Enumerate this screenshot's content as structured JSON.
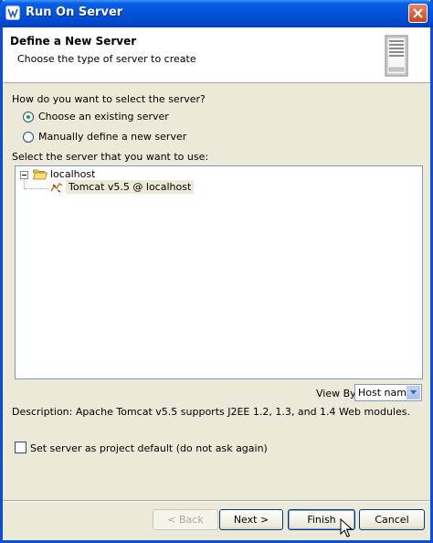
{
  "window": {
    "title": "Run On Server"
  },
  "banner": {
    "title": "Define a New Server",
    "subtitle": "Choose the type of server to create"
  },
  "selection": {
    "question": "How do you want to select the server?",
    "options": [
      {
        "label": "Choose an existing server",
        "checked": true
      },
      {
        "label": "Manually define a new server",
        "checked": false
      }
    ]
  },
  "server_list": {
    "label": "Select the server that you want to use:",
    "tree": {
      "host": "localhost",
      "expanded": true,
      "servers": [
        {
          "label": "Tomcat v5.5 @ localhost",
          "selected": true
        }
      ]
    }
  },
  "view_by": {
    "label": "View By:",
    "value": "Host name"
  },
  "description": "Description: Apache Tomcat v5.5 supports J2EE 1.2, 1.3, and 1.4 Web modules.",
  "default_checkbox": {
    "label": "Set server as project default (do not ask again)",
    "checked": false
  },
  "buttons": {
    "back": "< Back",
    "next": "Next >",
    "finish": "Finish",
    "cancel": "Cancel"
  },
  "colors": {
    "title_bar": "#0453d8",
    "dialog_bg": "#ece9d8",
    "button_border": "#003c74"
  }
}
